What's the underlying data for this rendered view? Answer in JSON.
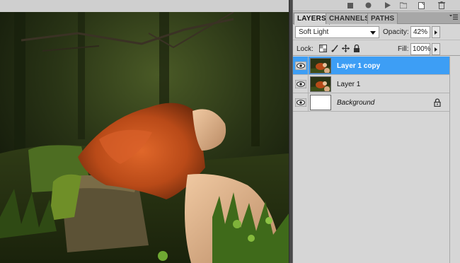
{
  "toolbar": {
    "icons": [
      "stop-icon",
      "record-icon",
      "play-icon",
      "new-set-icon",
      "new-action-icon",
      "trash-icon"
    ]
  },
  "tabs": [
    {
      "label": "LAYERS",
      "active": true
    },
    {
      "label": "CHANNELS",
      "active": false
    },
    {
      "label": "PATHS",
      "active": false
    }
  ],
  "blend": {
    "mode": "Soft Light",
    "opacity_label": "Opacity:",
    "opacity_value": "42%"
  },
  "lock": {
    "label": "Lock:",
    "fill_label": "Fill:",
    "fill_value": "100%"
  },
  "layers": [
    {
      "name": "Layer 1 copy",
      "selected": true,
      "visible": true,
      "thumb": "photo"
    },
    {
      "name": "Layer 1",
      "selected": false,
      "visible": true,
      "thumb": "photo"
    },
    {
      "name": "Background",
      "selected": false,
      "visible": true,
      "thumb": "white",
      "locked": true
    }
  ],
  "colors": {
    "selection": "#3d9ef5",
    "panel": "#d6d6d6",
    "hair": "#c2501c"
  }
}
